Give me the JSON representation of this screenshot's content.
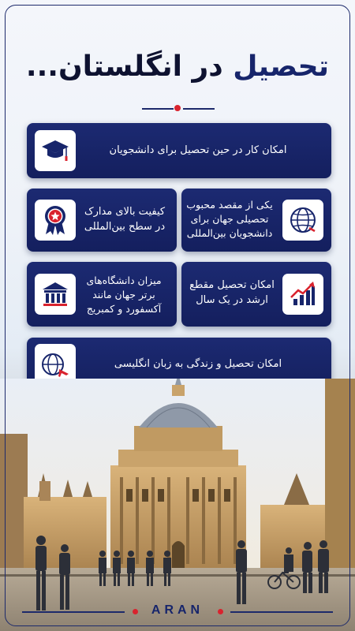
{
  "title": {
    "part_highlight": "تحصیل",
    "part_rest": "در انگلستان..."
  },
  "cards": [
    {
      "text": "امکان کار در حین تحصیل برای دانشجویان",
      "icon": "graduation-cap-icon"
    },
    {
      "text": "کیفیت بالای مدارک در سطح بین‌المللی",
      "icon": "award-badge-icon"
    },
    {
      "text": "یکی از مقصد محبوب تحصیلی جهان برای دانشجویان بین‌المللی",
      "icon": "globe-icon"
    },
    {
      "text": "میزان دانشگاه‌های برتر جهان مانند آکسفورد و کمبریج",
      "icon": "university-building-icon"
    },
    {
      "text": "امکان تحصیل مقطع ارشد در یک سال",
      "icon": "growth-chart-icon"
    },
    {
      "text": "امکان تحصیل و زندگی به زبان انگلیسی",
      "icon": "globe-plane-icon"
    }
  ],
  "brand": "ARAN",
  "colors": {
    "navy": "#17256b",
    "accent_red": "#d9232e",
    "card_bg": "#1c2a72"
  }
}
